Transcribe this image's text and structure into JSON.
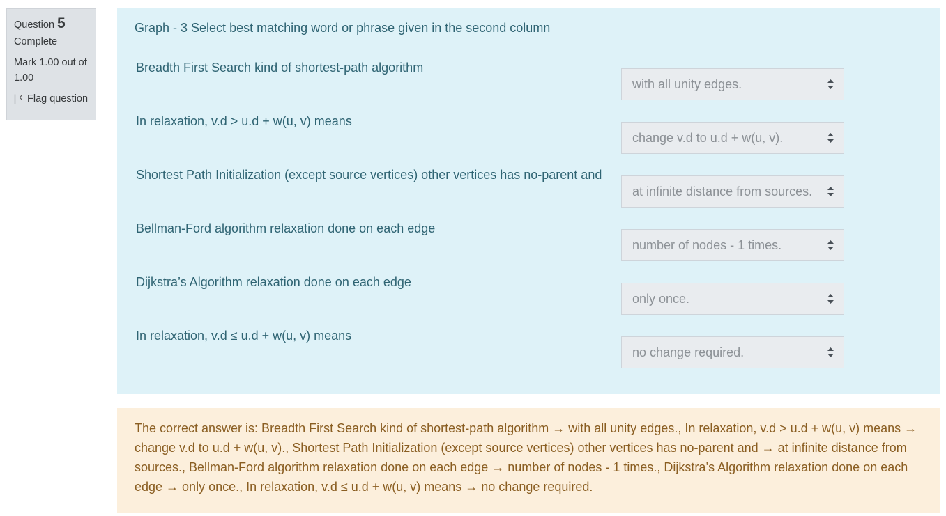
{
  "info": {
    "question_label": "Question",
    "question_number": "5",
    "state": "Complete",
    "grade": "Mark 1.00 out of 1.00",
    "flag_label": "Flag question"
  },
  "question": {
    "text": "Graph - 3 Select best matching word or phrase given in the second column",
    "rows": [
      {
        "label": "Breadth First Search kind of shortest-path algorithm",
        "selected": "with all unity edges."
      },
      {
        "label": "In relaxation, v.d > u.d + w(u, v) means",
        "selected": "change v.d to u.d + w(u, v)."
      },
      {
        "label": "Shortest Path Initialization (except source vertices) other vertices has no-parent and",
        "selected": "at infinite distance from sources."
      },
      {
        "label": "Bellman-Ford algorithm relaxation done on each edge",
        "selected": "number of nodes - 1 times."
      },
      {
        "label": "Dijkstra’s Algorithm relaxation done on each edge",
        "selected": "only once."
      },
      {
        "label": "In relaxation, v.d ≤ u.d + w(u, v) means",
        "selected": "no change required."
      }
    ]
  },
  "feedback": {
    "right_answer": "The correct answer is: Breadth First Search kind of shortest-path algorithm → with all unity edges., In relaxation, v.d > u.d + w(u, v) means → change v.d to u.d + w(u, v)., Shortest Path Initialization (except source vertices) other vertices has no-parent and → at infinite distance from sources., Bellman-Ford algorithm relaxation done on each edge → number of nodes - 1 times., Dijkstra’s Algorithm relaxation done on each edge → only once., In relaxation, v.d ≤ u.d + w(u, v) means → no change required."
  },
  "icons": {
    "flag": "flag-icon",
    "select_arrows": "sort-arrows-icon"
  },
  "colors": {
    "info_bg": "#dee2e6",
    "question_bg": "#def2f8",
    "question_text": "#2f6473",
    "feedback_bg": "#fcefdc",
    "feedback_text": "#8a5e22"
  }
}
